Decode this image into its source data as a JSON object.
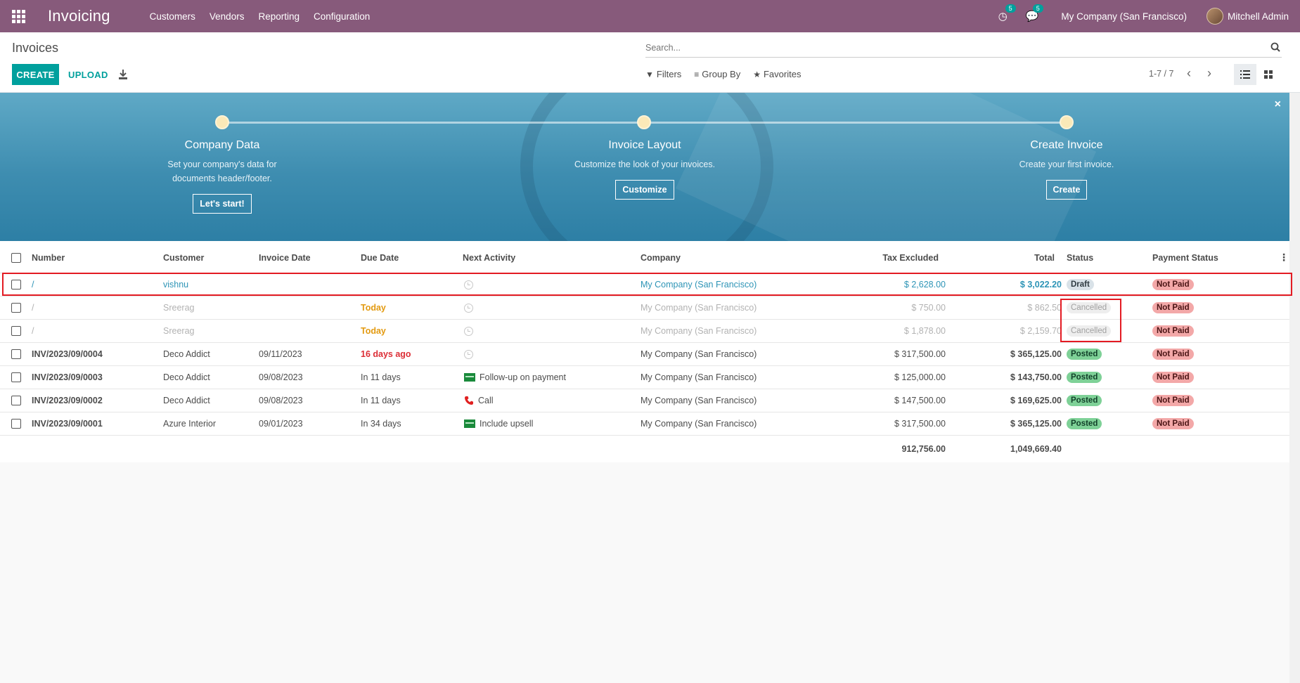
{
  "navbar": {
    "app_name": "Invoicing",
    "menu": [
      "Customers",
      "Vendors",
      "Reporting",
      "Configuration"
    ],
    "activity_count": "5",
    "message_count": "5",
    "company": "My Company (San Francisco)",
    "user": "Mitchell Admin",
    "bg_color": "#875a7b"
  },
  "control_panel": {
    "title": "Invoices",
    "create_label": "CREATE",
    "upload_label": "UPLOAD",
    "search_placeholder": "Search...",
    "filters_label": "Filters",
    "group_by_label": "Group By",
    "favorites_label": "Favorites",
    "pager": "1-7 / 7"
  },
  "banner": {
    "steps": [
      {
        "title": "Company Data",
        "desc": "Set your company's data for documents header/footer.",
        "button": "Let's start!"
      },
      {
        "title": "Invoice Layout",
        "desc": "Customize the look of your invoices.",
        "button": "Customize"
      },
      {
        "title": "Create Invoice",
        "desc": "Create your first invoice.",
        "button": "Create"
      }
    ],
    "close": "×"
  },
  "table": {
    "columns": [
      "Number",
      "Customer",
      "Invoice Date",
      "Due Date",
      "Next Activity",
      "Company",
      "Tax Excluded",
      "Total",
      "Status",
      "Payment Status"
    ],
    "rows": [
      {
        "number": "/",
        "customer": "vishnu",
        "invoice_date": "",
        "due_date": "",
        "activity": "",
        "company": "My Company (San Francisco)",
        "tax_excluded": "$ 2,628.00",
        "total": "$ 3,022.20",
        "status": "Draft",
        "payment": "Not Paid"
      },
      {
        "number": "/",
        "customer": "Sreerag",
        "invoice_date": "",
        "due_date": "Today",
        "activity": "",
        "company": "My Company (San Francisco)",
        "tax_excluded": "$ 750.00",
        "total": "$ 862.50",
        "status": "Cancelled",
        "payment": "Not Paid"
      },
      {
        "number": "/",
        "customer": "Sreerag",
        "invoice_date": "",
        "due_date": "Today",
        "activity": "",
        "company": "My Company (San Francisco)",
        "tax_excluded": "$ 1,878.00",
        "total": "$ 2,159.70",
        "status": "Cancelled",
        "payment": "Not Paid"
      },
      {
        "number": "INV/2023/09/0004",
        "customer": "Deco Addict",
        "invoice_date": "09/11/2023",
        "due_date": "16 days ago",
        "activity": "",
        "company": "My Company (San Francisco)",
        "tax_excluded": "$ 317,500.00",
        "total": "$ 365,125.00",
        "status": "Posted",
        "payment": "Not Paid"
      },
      {
        "number": "INV/2023/09/0003",
        "customer": "Deco Addict",
        "invoice_date": "09/08/2023",
        "due_date": "In 11 days",
        "activity": "Follow-up on payment",
        "company": "My Company (San Francisco)",
        "tax_excluded": "$ 125,000.00",
        "total": "$ 143,750.00",
        "status": "Posted",
        "payment": "Not Paid"
      },
      {
        "number": "INV/2023/09/0002",
        "customer": "Deco Addict",
        "invoice_date": "09/08/2023",
        "due_date": "In 11 days",
        "activity": "Call",
        "company": "My Company (San Francisco)",
        "tax_excluded": "$ 147,500.00",
        "total": "$ 169,625.00",
        "status": "Posted",
        "payment": "Not Paid"
      },
      {
        "number": "INV/2023/09/0001",
        "customer": "Azure Interior",
        "invoice_date": "09/01/2023",
        "due_date": "In 34 days",
        "activity": "Include upsell",
        "company": "My Company (San Francisco)",
        "tax_excluded": "$ 317,500.00",
        "total": "$ 365,125.00",
        "status": "Posted",
        "payment": "Not Paid"
      }
    ],
    "totals": {
      "tax_excluded": "912,756.00",
      "total": "1,049,669.40"
    }
  }
}
